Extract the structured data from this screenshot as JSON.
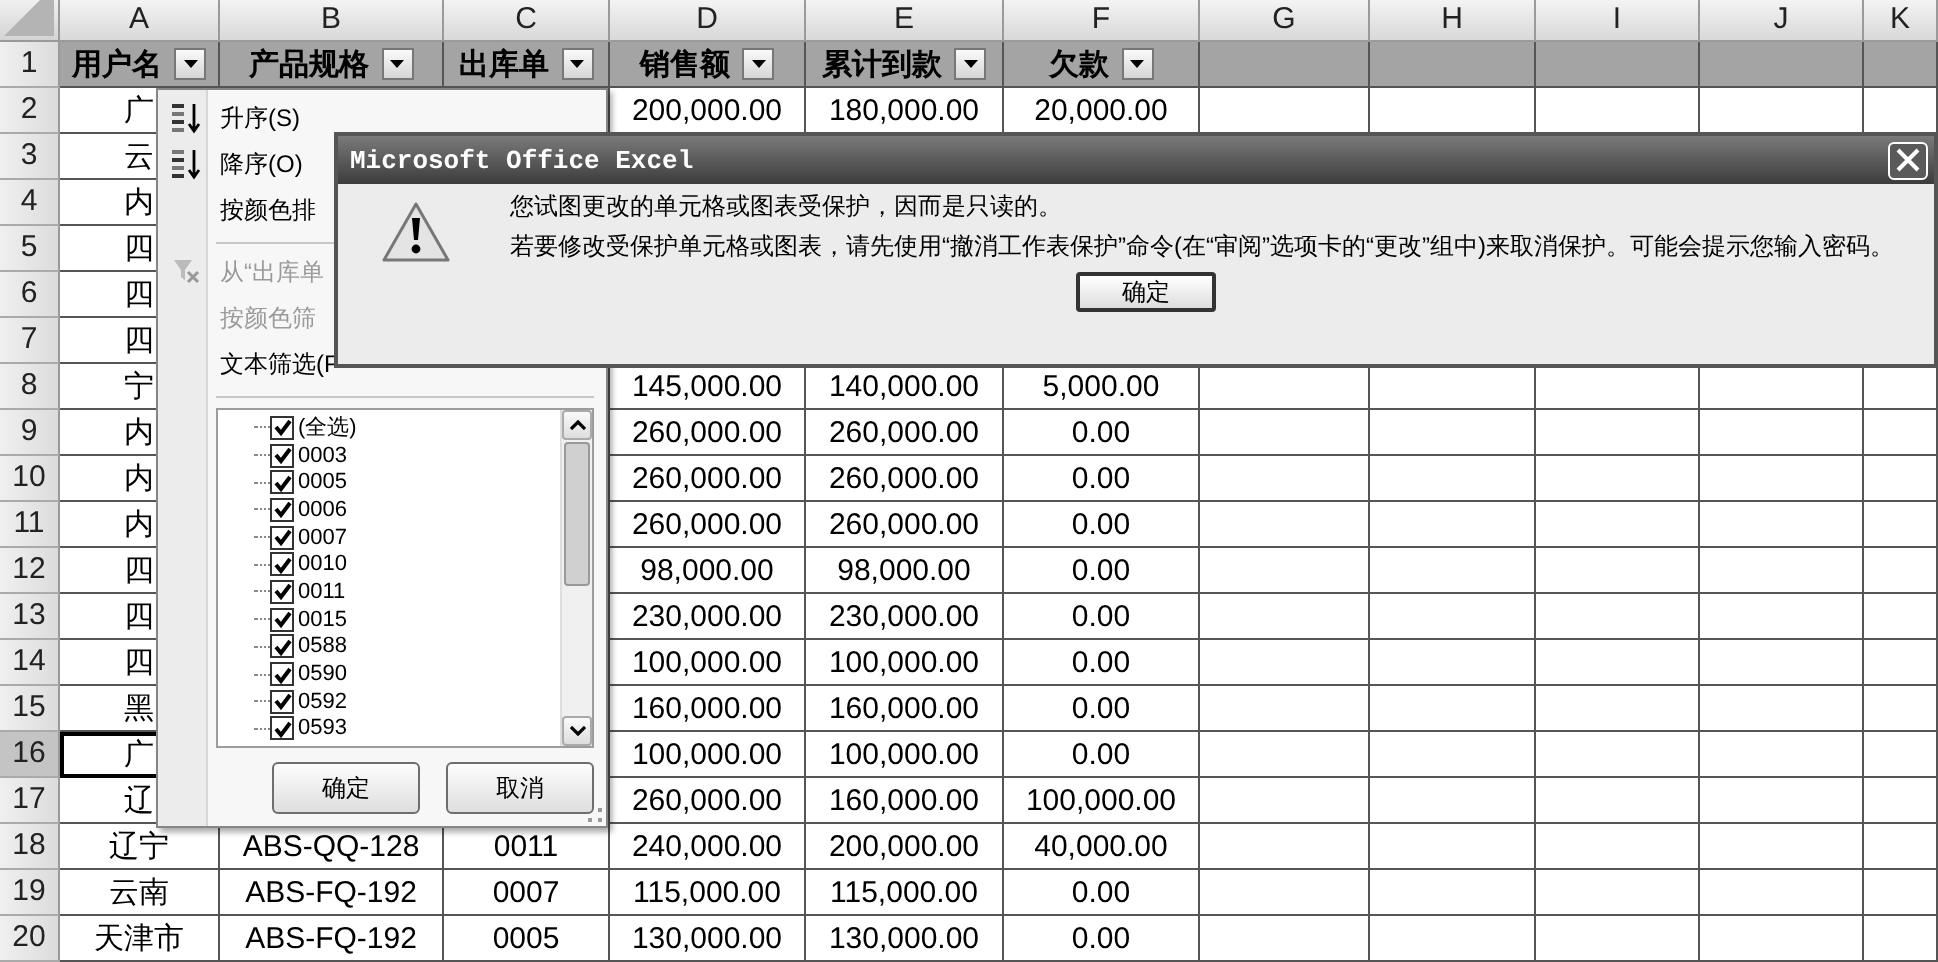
{
  "sheet": {
    "columns": [
      "A",
      "B",
      "C",
      "D",
      "E",
      "F",
      "G",
      "H",
      "I",
      "J",
      "K"
    ],
    "rows": [
      {
        "number": "1",
        "selected": false,
        "kind": "header",
        "cells": {
          "A": "用户名",
          "B": "产品规格",
          "C": "出库单",
          "D": "销售额",
          "E": "累计到款",
          "F": "欠款"
        }
      },
      {
        "number": "2",
        "selected": false,
        "kind": "data",
        "cells": {
          "A": "广",
          "D": "200,000.00",
          "E": "180,000.00",
          "F": "20,000.00"
        }
      },
      {
        "number": "3",
        "selected": false,
        "kind": "data",
        "cells": {
          "A": "云"
        }
      },
      {
        "number": "4",
        "selected": false,
        "kind": "data",
        "cells": {
          "A": "内"
        }
      },
      {
        "number": "5",
        "selected": false,
        "kind": "data",
        "cells": {
          "A": "四"
        }
      },
      {
        "number": "6",
        "selected": false,
        "kind": "data",
        "cells": {
          "A": "四"
        }
      },
      {
        "number": "7",
        "selected": false,
        "kind": "data",
        "cells": {
          "A": "四"
        }
      },
      {
        "number": "8",
        "selected": false,
        "kind": "data",
        "cells": {
          "A": "宁",
          "D": "145,000.00",
          "E": "140,000.00",
          "F": "5,000.00"
        }
      },
      {
        "number": "9",
        "selected": false,
        "kind": "data",
        "cells": {
          "A": "内",
          "D": "260,000.00",
          "E": "260,000.00",
          "F": "0.00"
        }
      },
      {
        "number": "10",
        "selected": false,
        "kind": "data",
        "cells": {
          "A": "内",
          "D": "260,000.00",
          "E": "260,000.00",
          "F": "0.00"
        }
      },
      {
        "number": "11",
        "selected": false,
        "kind": "data",
        "cells": {
          "A": "内",
          "D": "260,000.00",
          "E": "260,000.00",
          "F": "0.00"
        }
      },
      {
        "number": "12",
        "selected": false,
        "kind": "data",
        "cells": {
          "A": "四",
          "D": "98,000.00",
          "E": "98,000.00",
          "F": "0.00"
        }
      },
      {
        "number": "13",
        "selected": false,
        "kind": "data",
        "cells": {
          "A": "四",
          "D": "230,000.00",
          "E": "230,000.00",
          "F": "0.00"
        }
      },
      {
        "number": "14",
        "selected": false,
        "kind": "data",
        "cells": {
          "A": "四",
          "D": "100,000.00",
          "E": "100,000.00",
          "F": "0.00"
        }
      },
      {
        "number": "15",
        "selected": false,
        "kind": "data",
        "cells": {
          "A": "黑",
          "D": "160,000.00",
          "E": "160,000.00",
          "F": "0.00"
        }
      },
      {
        "number": "16",
        "selected": true,
        "kind": "data",
        "cells": {
          "A": "广",
          "D": "100,000.00",
          "E": "100,000.00",
          "F": "0.00"
        }
      },
      {
        "number": "17",
        "selected": false,
        "kind": "data",
        "cells": {
          "A": "辽",
          "D": "260,000.00",
          "E": "160,000.00",
          "F": "100,000.00"
        }
      },
      {
        "number": "18",
        "selected": false,
        "kind": "data",
        "cells": {
          "A": "辽宁",
          "B": "ABS-QQ-128",
          "C": "0011",
          "D": "240,000.00",
          "E": "200,000.00",
          "F": "40,000.00"
        }
      },
      {
        "number": "19",
        "selected": false,
        "kind": "data",
        "cells": {
          "A": "云南",
          "B": "ABS-FQ-192",
          "C": "0007",
          "D": "115,000.00",
          "E": "115,000.00",
          "F": "0.00"
        }
      },
      {
        "number": "20",
        "selected": false,
        "kind": "data",
        "cells": {
          "A": "天津市",
          "B": "ABS-FQ-192",
          "C": "0005",
          "D": "130,000.00",
          "E": "130,000.00",
          "F": "0.00"
        }
      }
    ]
  },
  "filter_menu": {
    "items": [
      {
        "label": "升序(S)",
        "kind": "sort_ascending",
        "disabled": false
      },
      {
        "label": "降序(O)",
        "kind": "sort_descending",
        "disabled": false
      },
      {
        "label": "按颜色排",
        "kind": "plain",
        "disabled": false
      },
      {
        "kind": "separator"
      },
      {
        "label": "从“出库单",
        "kind": "clear_filter",
        "disabled": true
      },
      {
        "label": "按颜色筛",
        "kind": "plain",
        "disabled": true
      },
      {
        "label": "文本筛选(F",
        "kind": "plain",
        "disabled": false
      },
      {
        "kind": "separator"
      }
    ],
    "values": [
      {
        "label": "(全选)",
        "checked": true
      },
      {
        "label": "0003",
        "checked": true
      },
      {
        "label": "0005",
        "checked": true
      },
      {
        "label": "0006",
        "checked": true
      },
      {
        "label": "0007",
        "checked": true
      },
      {
        "label": "0010",
        "checked": true
      },
      {
        "label": "0011",
        "checked": true
      },
      {
        "label": "0015",
        "checked": true
      },
      {
        "label": "0588",
        "checked": true
      },
      {
        "label": "0590",
        "checked": true
      },
      {
        "label": "0592",
        "checked": true
      },
      {
        "label": "0593",
        "checked": true
      }
    ],
    "buttons": [
      "确定",
      "取消"
    ]
  },
  "dialog": {
    "title": "Microsoft Office Excel",
    "messages": [
      "您试图更改的单元格或图表受保护，因而是只读的。",
      "若要修改受保护单元格或图表，请先使用“撤消工作表保护”命令(在“审阅”选项卡的“更改”组中)来取消保护。可能会提示您输入密码。"
    ],
    "button": "确定"
  }
}
